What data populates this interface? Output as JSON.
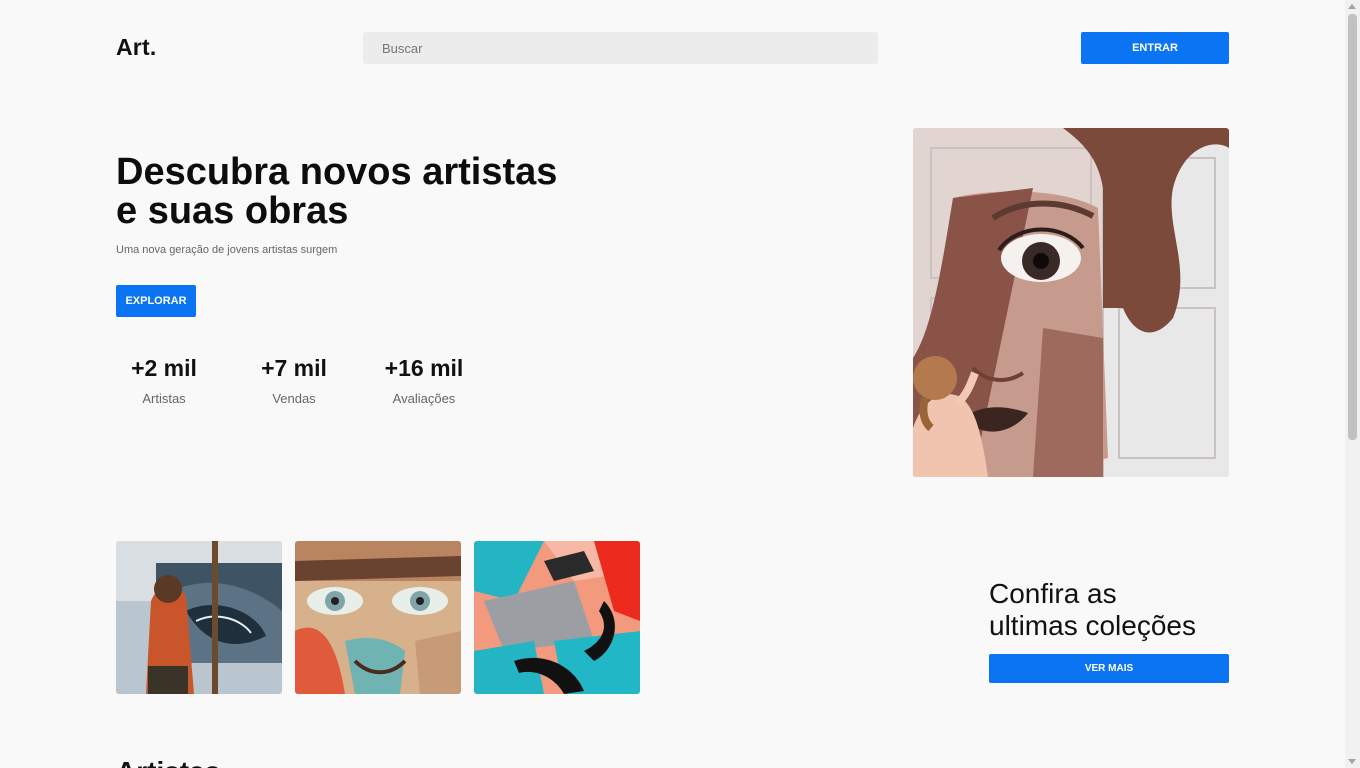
{
  "header": {
    "logo": "Art.",
    "search_placeholder": "Buscar",
    "login_label": "ENTRAR"
  },
  "hero": {
    "title_line1": "Descubra novos artistas",
    "title_line2": "e suas obras",
    "subtitle": "Uma nova geração de jovens artistas surgem",
    "explore_label": "EXPLORAR",
    "stats": [
      {
        "value": "+2 mil",
        "label": "Artistas"
      },
      {
        "value": "+7 mil",
        "label": "Vendas"
      },
      {
        "value": "+16 mil",
        "label": "Avaliações"
      }
    ],
    "image_subject": "mural-face-painting-photo"
  },
  "collections": {
    "title_line1": "Confira as",
    "title_line2": "ultimas coleções",
    "more_label": "VER MAIS",
    "thumbnails": [
      {
        "subject": "artist-at-easel-photo"
      },
      {
        "subject": "graffiti-face-photo"
      },
      {
        "subject": "abstract-mural-photo"
      }
    ]
  },
  "next_section": {
    "title": "Artistas"
  },
  "colors": {
    "accent": "#0b74f3",
    "background": "#f9f9f9"
  }
}
